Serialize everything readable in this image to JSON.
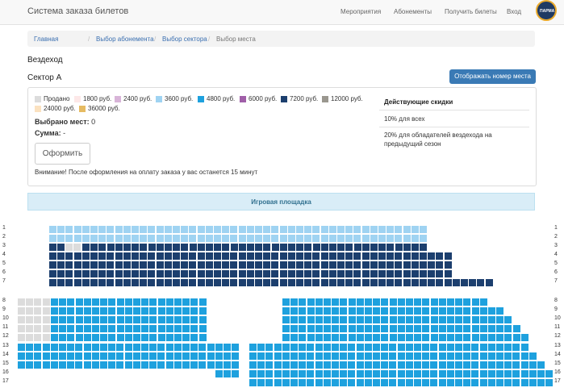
{
  "navbar": {
    "brand": "Система заказа билетов",
    "items": [
      "Мероприятия",
      "Абонементы",
      "Получить билеты",
      "Вход"
    ],
    "logo_text": "ПАРМА"
  },
  "breadcrumb": [
    "Главная",
    "Выбор абонемента",
    "Выбор сектора",
    "Выбор места"
  ],
  "event_title": "Вездеход",
  "sector_title": "Сектор A",
  "show_seat_button": "Отображать номер места",
  "legend": [
    {
      "label": "Продано",
      "color": "#dcdcdc"
    },
    {
      "label": "1800 руб.",
      "color": "#fde8e8"
    },
    {
      "label": "2400 руб.",
      "color": "#d8b4d8"
    },
    {
      "label": "3600 руб.",
      "color": "#9fd3f2"
    },
    {
      "label": "4800 руб.",
      "color": "#1ea1de"
    },
    {
      "label": "6000 руб.",
      "color": "#a05fa8"
    },
    {
      "label": "7200 руб.",
      "color": "#1c3f6e"
    },
    {
      "label": "12000 руб.",
      "color": "#9a978f"
    },
    {
      "label": "24000 руб.",
      "color": "#fbe2c0"
    },
    {
      "label": "36000 руб.",
      "color": "#e6bb62"
    }
  ],
  "selection": {
    "selected_label": "Выбрано мест:",
    "selected_value": "0",
    "sum_label": "Сумма:",
    "sum_value": "-"
  },
  "order_button": "Оформить",
  "warning": "Внимание! После оформления на оплату заказа у вас останется 15 минут",
  "discounts": {
    "title": "Действующие скидки",
    "items": [
      "10% для всех",
      "20% для обладателей вездехода на предыдущий сезон"
    ]
  },
  "playground_label": "Игровая площадка",
  "seatmap": {
    "rows": [
      "1",
      "2",
      "3",
      "4",
      "5",
      "6",
      "7",
      "8",
      "9",
      "10",
      "11",
      "12",
      "13",
      "14",
      "15",
      "16",
      "17"
    ],
    "colors": {
      "sold": "#dcdcdc",
      "light": "#9fd3f2",
      "dark": "#1c3f6e",
      "blue": "#1ea1de"
    }
  }
}
